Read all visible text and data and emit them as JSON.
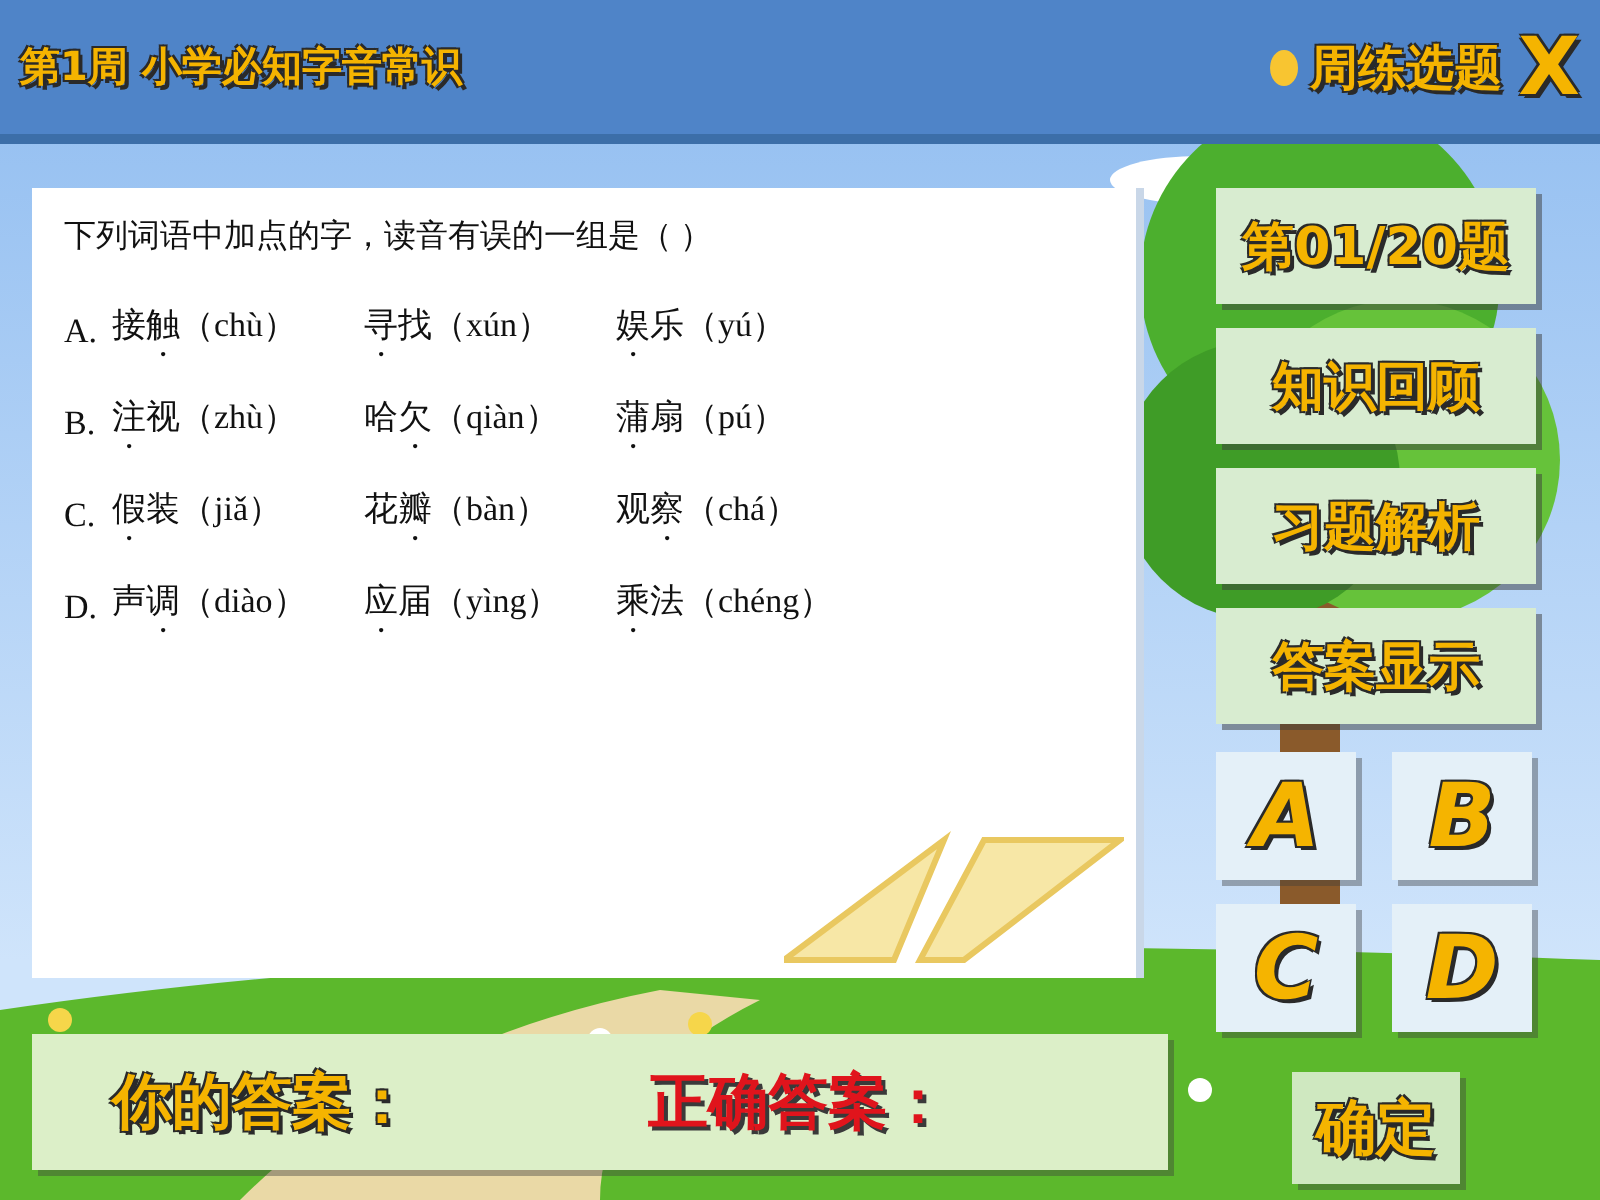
{
  "header": {
    "title": "第1周 小学必知字音常识",
    "menu_label": "周练选题",
    "close": "X"
  },
  "question": {
    "prompt": "下列词语中加点的字，读音有误的一组是（      ）",
    "options": [
      {
        "letter": "A.",
        "words": [
          {
            "pre": "接",
            "dot": "触",
            "pinyin": "（chù）"
          },
          {
            "dot": "寻",
            "post": "找",
            "pinyin": "（xún）"
          },
          {
            "dot": "娱",
            "post": "乐",
            "pinyin": "（yú）"
          }
        ]
      },
      {
        "letter": "B.",
        "words": [
          {
            "dot": "注",
            "post": "视",
            "pinyin": "（zhù）"
          },
          {
            "pre": "哈",
            "dot": "欠",
            "pinyin": "（qiàn）"
          },
          {
            "dot": "蒲",
            "post": "扇",
            "pinyin": "（pú）"
          }
        ]
      },
      {
        "letter": "C.",
        "words": [
          {
            "dot": "假",
            "post": "装",
            "pinyin": "（jiǎ）"
          },
          {
            "pre": "花",
            "dot": "瓣",
            "pinyin": "（bàn）"
          },
          {
            "pre": "观",
            "dot": "察",
            "pinyin": "（chá）"
          }
        ]
      },
      {
        "letter": "D.",
        "words": [
          {
            "pre": "声",
            "dot": "调",
            "pinyin": "（diào）"
          },
          {
            "dot": "应",
            "post": "届",
            "pinyin": "（yìng）"
          },
          {
            "dot": "乘",
            "post": "法",
            "pinyin": "（chéng）"
          }
        ]
      }
    ]
  },
  "side_buttons": [
    "第01/20题",
    "知识回顾",
    "习题解析",
    "答案显示"
  ],
  "choices": [
    "A",
    "B",
    "C",
    "D"
  ],
  "confirm": "确定",
  "answer_bar": {
    "yours": "你的答案：",
    "correct": "正确答案："
  }
}
